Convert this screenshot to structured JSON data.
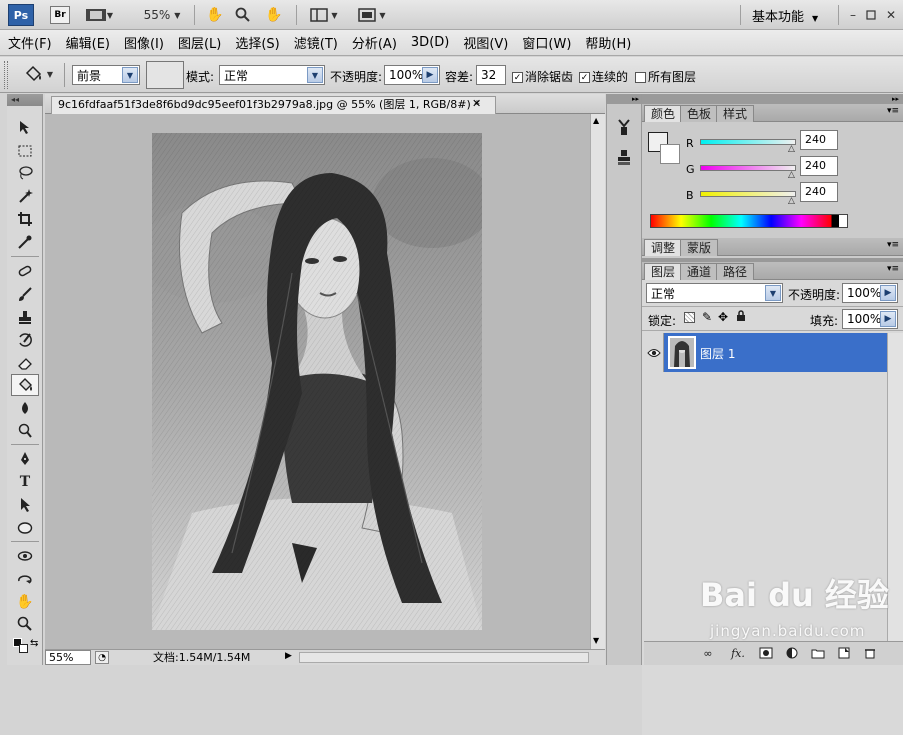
{
  "appbar": {
    "ps_label": "Ps",
    "br_label": "Br",
    "zoom": "55%",
    "workspace": "基本功能"
  },
  "menu": [
    "文件(F)",
    "编辑(E)",
    "图像(I)",
    "图层(L)",
    "选择(S)",
    "滤镜(T)",
    "分析(A)",
    "3D(D)",
    "视图(V)",
    "窗口(W)",
    "帮助(H)"
  ],
  "options": {
    "fill_source": "前景",
    "mode_label": "模式:",
    "mode_value": "正常",
    "opacity_label": "不透明度:",
    "opacity_value": "100%",
    "tolerance_label": "容差:",
    "tolerance_value": "32",
    "antialias_label": "消除锯齿",
    "contiguous_label": "连续的",
    "all_layers_label": "所有图层"
  },
  "document": {
    "tab_title": "9c16fdfaaf51f3de8f6bd9dc95eef01f3b2979a8.jpg @ 55% (图层 1, RGB/8#) *",
    "zoom": "55%",
    "doc_size": "文档:1.54M/1.54M"
  },
  "color_panel": {
    "tabs": [
      "颜色",
      "色板",
      "样式"
    ],
    "r_label": "R",
    "r_value": "240",
    "g_label": "G",
    "g_value": "240",
    "b_label": "B",
    "b_value": "240"
  },
  "adjust_panel": {
    "tabs": [
      "调整",
      "蒙版"
    ]
  },
  "layers_panel": {
    "tabs": [
      "图层",
      "通道",
      "路径"
    ],
    "blend_mode": "正常",
    "opacity_label": "不透明度:",
    "opacity_value": "100%",
    "lock_label": "锁定:",
    "fill_label": "填充:",
    "fill_value": "100%",
    "layer_name": "图层 1"
  },
  "watermark": {
    "logo": "Bai du 经验",
    "url": "jingyan.baidu.com"
  },
  "colors": {
    "selected_layer": "#3a6fc9",
    "ps_blue": "#2f62a8"
  }
}
